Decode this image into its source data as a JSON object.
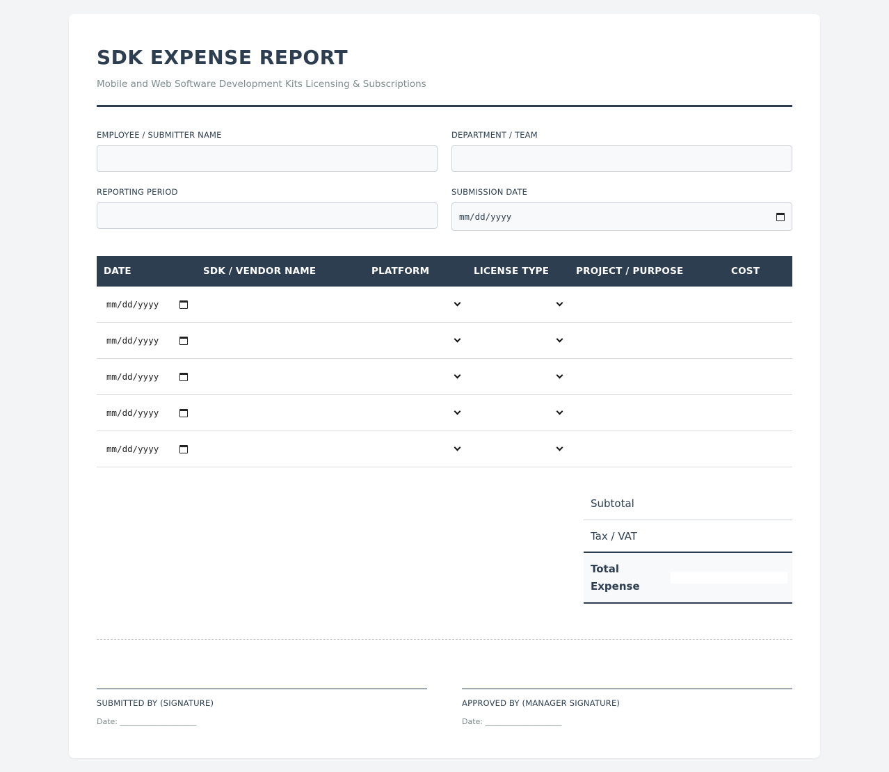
{
  "header": {
    "title": "SDK EXPENSE REPORT",
    "subtitle": "Mobile and Web Software Development Kits Licensing & Subscriptions"
  },
  "form": {
    "employee_label": "EMPLOYEE / SUBMITTER NAME",
    "department_label": "DEPARTMENT / TEAM",
    "period_label": "REPORTING PERIOD",
    "submission_label": "SUBMISSION DATE",
    "date_placeholder": "mm/dd/yyyy"
  },
  "table": {
    "headers": [
      "DATE",
      "SDK / VENDOR NAME",
      "PLATFORM",
      "LICENSE TYPE",
      "PROJECT / PURPOSE",
      "COST"
    ],
    "rows": [
      {
        "date": "mm/dd/yyyy"
      },
      {
        "date": "mm/dd/yyyy"
      },
      {
        "date": "mm/dd/yyyy"
      },
      {
        "date": "mm/dd/yyyy"
      },
      {
        "date": "mm/dd/yyyy"
      }
    ]
  },
  "totals": {
    "subtotal_label": "Subtotal",
    "tax_label": "Tax / VAT",
    "total_label_1": "Total",
    "total_label_2": "Expense"
  },
  "signatures": {
    "submitted_label": "SUBMITTED BY (SIGNATURE)",
    "approved_label": "APPROVED BY (MANAGER SIGNATURE)",
    "date_line": "Date: ____________________"
  },
  "colors": {
    "accent": "#2c3e50",
    "background": "#f3f4f6",
    "muted_text": "#7f8c8d"
  }
}
